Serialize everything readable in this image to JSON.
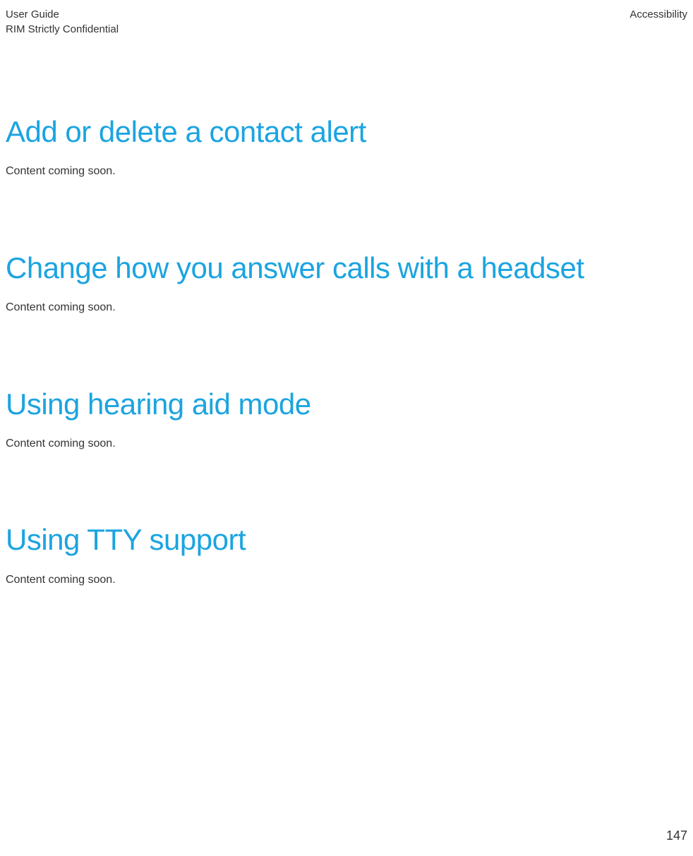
{
  "header": {
    "left_line1": "User Guide",
    "left_line2": "RIM Strictly Confidential",
    "right": "Accessibility"
  },
  "sections": [
    {
      "heading": "Add or delete a contact alert",
      "body": "Content coming soon."
    },
    {
      "heading": "Change how you answer calls with a headset",
      "body": "Content coming soon."
    },
    {
      "heading": "Using hearing aid mode",
      "body": "Content coming soon."
    },
    {
      "heading": "Using TTY support",
      "body": "Content coming soon."
    }
  ],
  "page_number": "147"
}
